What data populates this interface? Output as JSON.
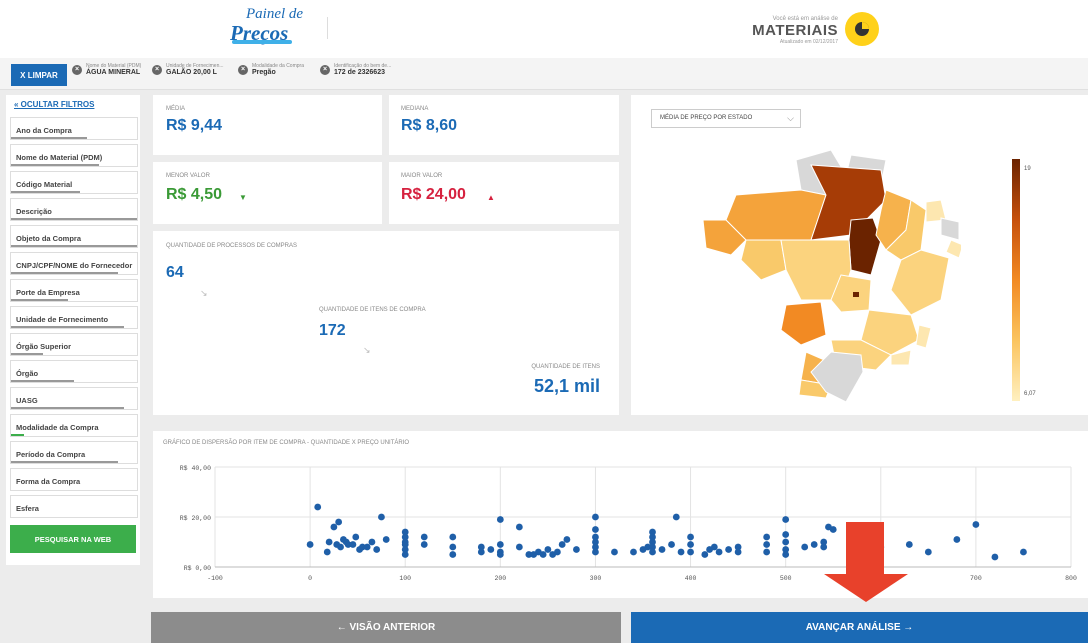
{
  "header": {
    "logo_top": "Painel de",
    "logo_bottom": "Preços",
    "analysis_note": "Você está em análise de",
    "analysis_type": "MATERIAIS",
    "updated": "Atualizado em 02/12/2017"
  },
  "filterbar": {
    "clear_label": "X  LIMPAR",
    "chips": [
      {
        "label": "Nome do Material (PDM)",
        "value": "ÁGUA MINERAL"
      },
      {
        "label": "Unidade de Fornecimen...",
        "value": "GALÃO 20,00 L"
      },
      {
        "label": "Modalidade da Compra",
        "value": "Pregão"
      },
      {
        "label": "Identificação do bem de...",
        "value": "172 de 2326623"
      }
    ]
  },
  "sidebar": {
    "hide_label": "« OCULTAR FILTROS",
    "filters": [
      {
        "label": "Ano da Compra",
        "fill": 0.6
      },
      {
        "label": "Nome do Material (PDM)",
        "fill": 0.7
      },
      {
        "label": "Código Material",
        "fill": 0.55
      },
      {
        "label": "Descrição",
        "fill": 1.0
      },
      {
        "label": "Objeto da Compra",
        "fill": 1.0
      },
      {
        "label": "CNPJ/CPF/NOME do Fornecedor",
        "fill": 0.85
      },
      {
        "label": "Porte da Empresa",
        "fill": 0.45
      },
      {
        "label": "Unidade de Fornecimento",
        "fill": 0.9
      },
      {
        "label": "Órgão Superior",
        "fill": 0.25
      },
      {
        "label": "Órgão",
        "fill": 0.5
      },
      {
        "label": "UASG",
        "fill": 0.9
      },
      {
        "label": "Modalidade da Compra",
        "fill": 0.1,
        "accent": "#3cae4b"
      },
      {
        "label": "Período da Compra",
        "fill": 0.85
      },
      {
        "label": "Forma da Compra",
        "fill": 0.0
      },
      {
        "label": "Esfera",
        "fill": 0.0
      }
    ],
    "search_web": "PESQUISAR NA WEB"
  },
  "stats": {
    "media_label": "MÉDIA",
    "media_value": "R$ 9,44",
    "mediana_label": "MEDIANA",
    "mediana_value": "R$ 8,60",
    "menor_label": "MENOR VALOR",
    "menor_value": "R$ 4,50",
    "menor_arrow": "▼",
    "maior_label": "MAIOR VALOR",
    "maior_value": "R$ 24,00",
    "maior_arrow": "▲",
    "processos_label": "QUANTIDADE DE PROCESSOS DE COMPRAS",
    "processos_value": "64",
    "itens_compra_label": "QUANTIDADE DE ITENS DE COMPRA",
    "itens_compra_value": "172",
    "itens_label": "QUANTIDADE DE ITENS",
    "itens_value": "52,1 mil"
  },
  "map": {
    "select_label": "MÉDIA DE PREÇO POR ESTADO",
    "legend_max": "19",
    "legend_min": "6,07"
  },
  "chart_data": {
    "type": "scatter",
    "title": "GRÁFICO DE DISPERSÃO POR ITEM DE COMPRA - QUANTIDADE X PREÇO UNITÁRIO",
    "xlabel": "",
    "ylabel": "",
    "xlim": [
      -100,
      800
    ],
    "ylim": [
      0,
      40
    ],
    "xticks": [
      "-100",
      "0",
      "100",
      "200",
      "300",
      "400",
      "500",
      "600",
      "700",
      "800"
    ],
    "yticks": [
      "R$ 0,00",
      "R$ 20,00",
      "R$ 40,00"
    ],
    "grid": true,
    "color": "#1f5fa8",
    "points": [
      [
        0,
        9
      ],
      [
        8,
        24
      ],
      [
        18,
        6
      ],
      [
        20,
        10
      ],
      [
        25,
        16
      ],
      [
        28,
        9
      ],
      [
        30,
        18
      ],
      [
        32,
        8
      ],
      [
        35,
        11
      ],
      [
        38,
        10
      ],
      [
        40,
        9
      ],
      [
        45,
        9
      ],
      [
        48,
        12
      ],
      [
        52,
        7
      ],
      [
        55,
        8
      ],
      [
        60,
        8
      ],
      [
        65,
        10
      ],
      [
        70,
        7
      ],
      [
        75,
        20
      ],
      [
        80,
        11
      ],
      [
        100,
        14
      ],
      [
        100,
        12
      ],
      [
        100,
        10
      ],
      [
        100,
        9
      ],
      [
        100,
        7
      ],
      [
        100,
        5
      ],
      [
        120,
        12
      ],
      [
        120,
        9
      ],
      [
        150,
        12
      ],
      [
        150,
        8
      ],
      [
        150,
        5
      ],
      [
        180,
        8
      ],
      [
        180,
        6
      ],
      [
        190,
        7
      ],
      [
        200,
        19
      ],
      [
        200,
        9
      ],
      [
        200,
        6
      ],
      [
        200,
        5
      ],
      [
        220,
        16
      ],
      [
        220,
        8
      ],
      [
        230,
        5
      ],
      [
        235,
        5
      ],
      [
        240,
        6
      ],
      [
        245,
        5
      ],
      [
        250,
        7
      ],
      [
        255,
        5
      ],
      [
        260,
        6
      ],
      [
        265,
        9
      ],
      [
        270,
        11
      ],
      [
        280,
        7
      ],
      [
        300,
        20
      ],
      [
        300,
        15
      ],
      [
        300,
        12
      ],
      [
        300,
        10
      ],
      [
        300,
        8
      ],
      [
        300,
        6
      ],
      [
        320,
        6
      ],
      [
        340,
        6
      ],
      [
        350,
        7
      ],
      [
        355,
        8
      ],
      [
        360,
        14
      ],
      [
        360,
        12
      ],
      [
        360,
        10
      ],
      [
        360,
        8
      ],
      [
        360,
        6
      ],
      [
        370,
        7
      ],
      [
        380,
        9
      ],
      [
        385,
        20
      ],
      [
        390,
        6
      ],
      [
        400,
        12
      ],
      [
        400,
        9
      ],
      [
        400,
        6
      ],
      [
        415,
        5
      ],
      [
        420,
        7
      ],
      [
        425,
        8
      ],
      [
        430,
        6
      ],
      [
        440,
        7
      ],
      [
        450,
        8
      ],
      [
        450,
        6
      ],
      [
        480,
        12
      ],
      [
        480,
        9
      ],
      [
        480,
        6
      ],
      [
        500,
        19
      ],
      [
        500,
        13
      ],
      [
        500,
        10
      ],
      [
        500,
        7
      ],
      [
        500,
        5
      ],
      [
        520,
        8
      ],
      [
        530,
        9
      ],
      [
        540,
        10
      ],
      [
        540,
        8
      ],
      [
        545,
        16
      ],
      [
        550,
        15
      ],
      [
        650,
        6
      ],
      [
        680,
        11
      ],
      [
        700,
        17
      ],
      [
        720,
        4
      ],
      [
        750,
        6
      ],
      [
        600,
        8
      ],
      [
        630,
        9
      ]
    ]
  },
  "nav": {
    "back_label": "←  VISÃO ANTERIOR",
    "next_label": "AVANÇAR ANÁLISE  →"
  }
}
